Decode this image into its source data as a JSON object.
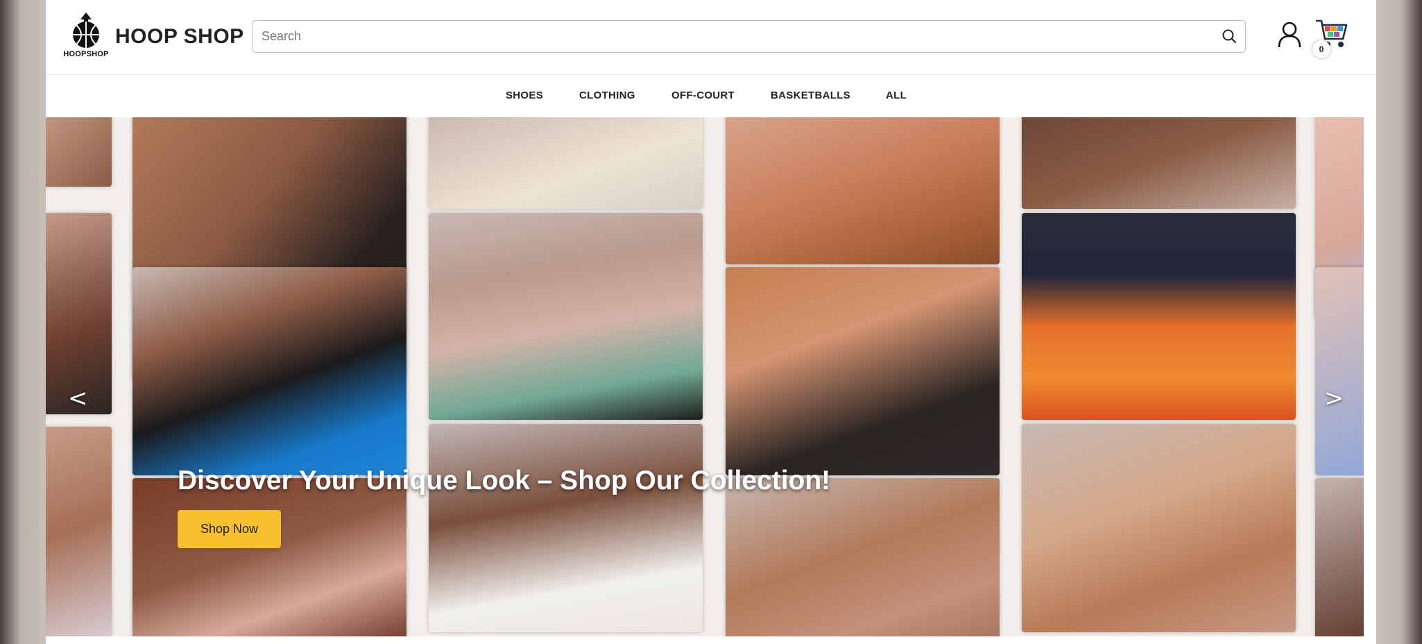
{
  "header": {
    "logo_text": "HOOPSHOP",
    "brand": "HOOP SHOP",
    "search": {
      "placeholder": "Search",
      "value": ""
    },
    "cart_count": "0"
  },
  "nav": {
    "items": [
      {
        "label": "SHOES"
      },
      {
        "label": "CLOTHING"
      },
      {
        "label": "OFF-COURT"
      },
      {
        "label": "BASKETBALLS"
      },
      {
        "label": "ALL"
      }
    ]
  },
  "hero": {
    "headline": "Discover Your Unique Look – Shop Our Collection!",
    "cta_label": "Shop Now",
    "prev_label": "<",
    "next_label": ">"
  },
  "colors": {
    "accent": "#f6c02e",
    "page_bg": "#ffffff"
  },
  "icons": [
    "basketball-logo-icon",
    "search-icon",
    "user-icon",
    "cart-icon"
  ]
}
